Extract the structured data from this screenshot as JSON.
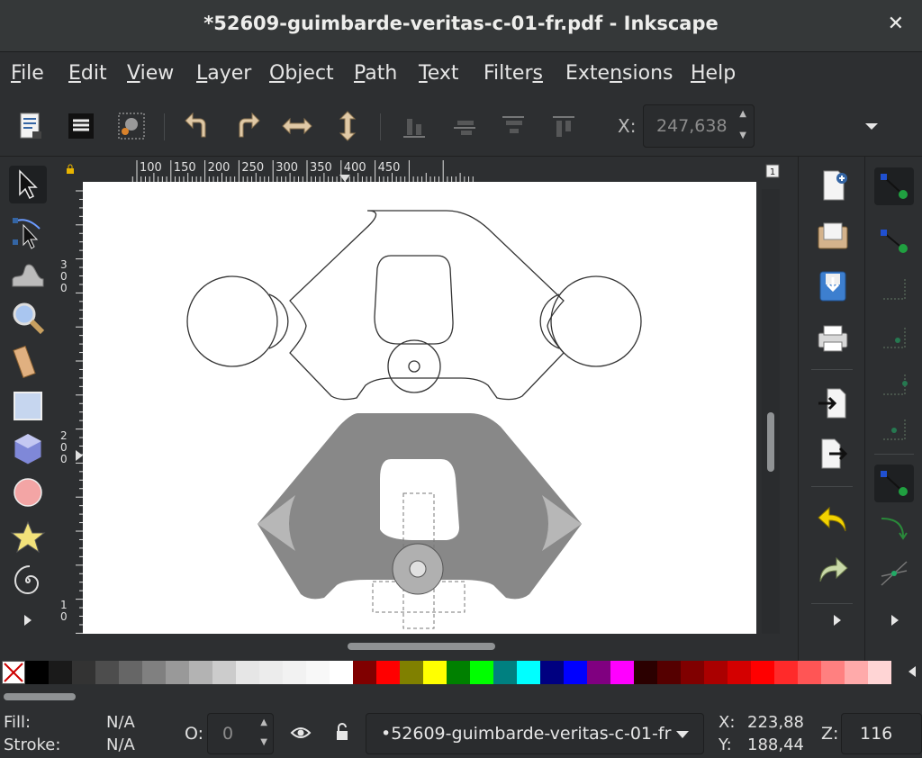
{
  "window": {
    "title": "*52609-guimbarde-veritas-c-01-fr.pdf - Inkscape",
    "close_glyph": "✕"
  },
  "menu": [
    {
      "pre": "",
      "u": "F",
      "post": "ile"
    },
    {
      "pre": "",
      "u": "E",
      "post": "dit"
    },
    {
      "pre": "",
      "u": "V",
      "post": "iew"
    },
    {
      "pre": "",
      "u": "L",
      "post": "ayer"
    },
    {
      "pre": "",
      "u": "O",
      "post": "bject"
    },
    {
      "pre": "",
      "u": "P",
      "post": "ath"
    },
    {
      "pre": "",
      "u": "T",
      "post": "ext"
    },
    {
      "pre": "Filter",
      "u": "s",
      "post": ""
    },
    {
      "pre": "Exte",
      "u": "n",
      "post": "sions"
    },
    {
      "pre": "",
      "u": "H",
      "post": "elp"
    }
  ],
  "toolbar": {
    "x_label": "X:",
    "x_value": "247,638"
  },
  "ruler": {
    "h_ticks": [
      "100",
      "150",
      "200",
      "250",
      "300",
      "350",
      "400",
      "450"
    ],
    "v_labels": [
      "3\n0\n0",
      "2\n0\n0",
      "1\n0"
    ]
  },
  "palette": {
    "colors": [
      "#000000",
      "#1a1a1a",
      "#333333",
      "#4d4d4d",
      "#666666",
      "#808080",
      "#999999",
      "#b3b3b3",
      "#cccccc",
      "#e6e6e6",
      "#ececec",
      "#f2f2f2",
      "#f8f8f8",
      "#ffffff",
      "#800000",
      "#ff0000",
      "#808000",
      "#ffff00",
      "#008000",
      "#00ff00",
      "#008080",
      "#00ffff",
      "#000080",
      "#0000ff",
      "#800080",
      "#ff00ff",
      "#2b0000",
      "#550000",
      "#800000",
      "#aa0000",
      "#d40000",
      "#ff0000",
      "#ff2a2a",
      "#ff5555",
      "#ff8080",
      "#ffaaaa",
      "#ffd5d5"
    ]
  },
  "status": {
    "fill_label": "Fill:",
    "fill_value": "N/A",
    "stroke_label": "Stroke:",
    "stroke_value": "N/A",
    "opacity_label": "O:",
    "opacity_value": "0",
    "layer_name": "•52609-guimbarde-veritas-c-01-fr",
    "x_label": "X:",
    "x_value": "223,88",
    "y_label": "Y:",
    "y_value": "188,44",
    "zoom_label": "Z:",
    "zoom_value": "116"
  }
}
